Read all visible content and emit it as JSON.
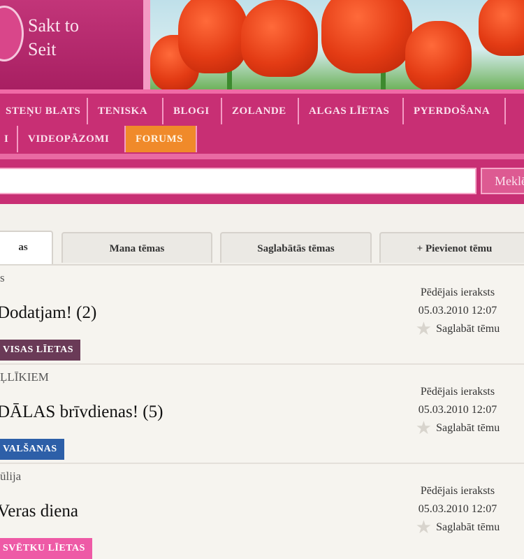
{
  "header": {
    "logo_text": "Sakt to\nSeit"
  },
  "nav": {
    "row1": [
      "STEŅU BLATS",
      "TENISKA",
      "BLOGI",
      "ZOLANDE",
      "ALGAS LĪETAS",
      "PYERDOŠANA",
      ""
    ],
    "row2": [
      "I",
      "VIDEOPĀZOMI",
      "FORUMS"
    ],
    "active": "FORUMS"
  },
  "search": {
    "value": "",
    "button_label": "Meklēt"
  },
  "tabs": [
    {
      "label": "as"
    },
    {
      "label": "Mana tēmas"
    },
    {
      "label": "Saglabātās tēmas"
    },
    {
      "label": "+ Pievienot tēmu"
    }
  ],
  "topics": [
    {
      "meta": "s",
      "title": "Dodatjam! (2)",
      "tag": "VISAS LĪETAS",
      "tag_color": "#6a3a57",
      "right_line1": "Pēdējais ieraksts",
      "right_line2": "05.03.2010 12:07",
      "bookmark_label": "Saglabāt tēmu"
    },
    {
      "meta": "ĻLĪKIEM",
      "title": "DĀLAS brīvdienas! (5)",
      "tag": "VALŠANAS",
      "tag_color": "#2d5fa8",
      "right_line1": "Pēdējais ieraksts",
      "right_line2": "05.03.2010 12:07",
      "bookmark_label": "Saglabāt tēmu"
    },
    {
      "meta": "ūlija",
      "title": "Veras diena",
      "tag": "SVĒTKU LĪETAS",
      "tag_color": "#ee5aa6",
      "right_line1": "Pēdējais ieraksts",
      "right_line2": "05.03.2010 12:07",
      "bookmark_label": "Saglabāt tēmu"
    }
  ]
}
